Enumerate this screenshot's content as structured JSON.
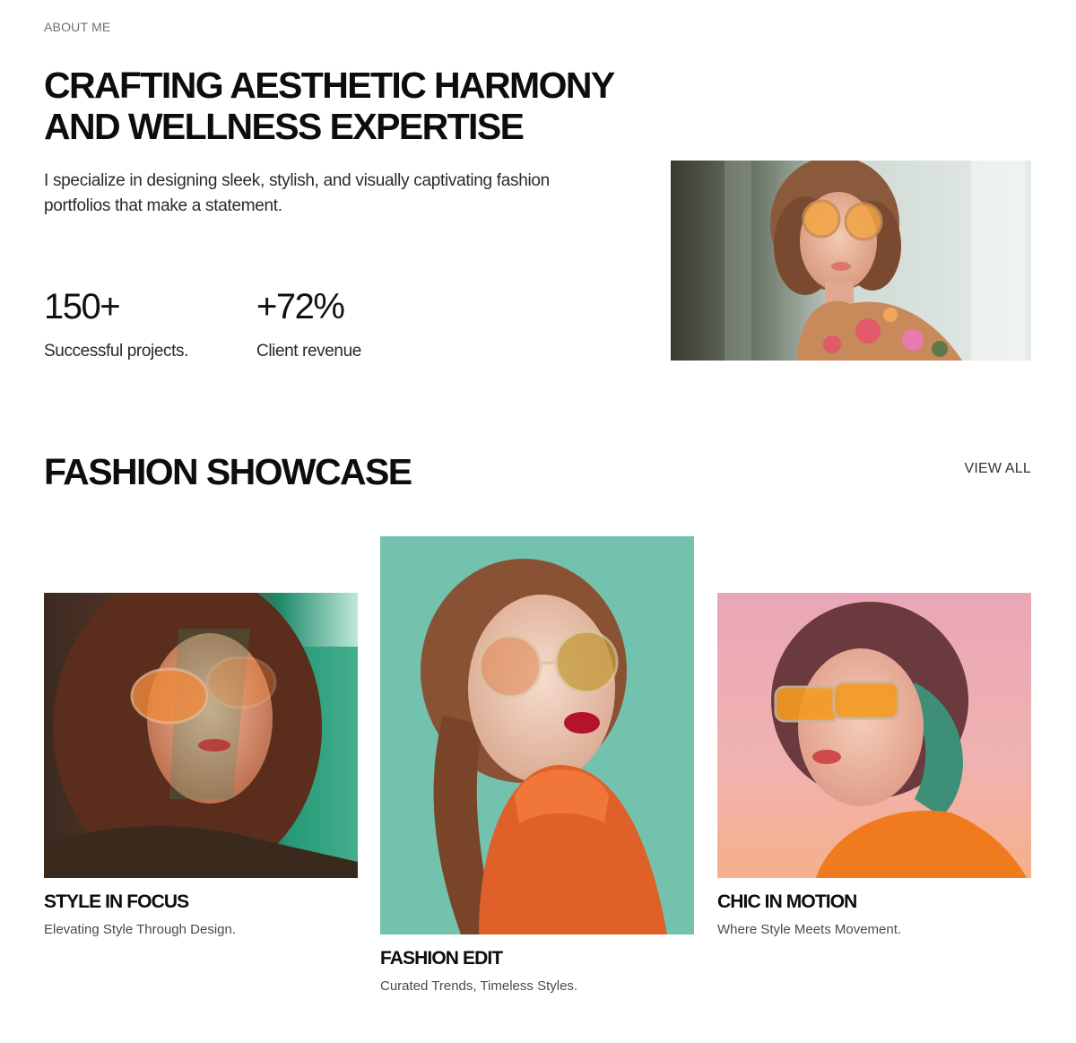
{
  "about": {
    "eyebrow": "ABOUT ME",
    "headline_line1": "CRAFTING AESTHETIC HARMONY",
    "headline_line2": "AND WELLNESS EXPERTISE",
    "intro_line1": "I specialize in designing sleek, stylish, and visually captivating fashion",
    "intro_line2": "portfolios that make a statement.",
    "stats": [
      {
        "value": "150+",
        "label": "Successful projects."
      },
      {
        "value": "+72%",
        "label": "Client revenue"
      }
    ]
  },
  "showcase": {
    "title": "FASHION SHOWCASE",
    "view_all": "VIEW ALL",
    "cards": [
      {
        "title": "STYLE IN FOCUS",
        "subtitle": "Elevating Style Through Design."
      },
      {
        "title": "FASHION EDIT",
        "subtitle": "Curated Trends, Timeless Styles."
      },
      {
        "title": "CHIC IN MOTION",
        "subtitle": "Where Style Meets Movement."
      }
    ]
  },
  "colors": {
    "text": "#0d0d0d",
    "muted": "#6f6f6f",
    "teal": "#73c2ad",
    "orange": "#e8652c",
    "pink": "#e9a6b6"
  }
}
